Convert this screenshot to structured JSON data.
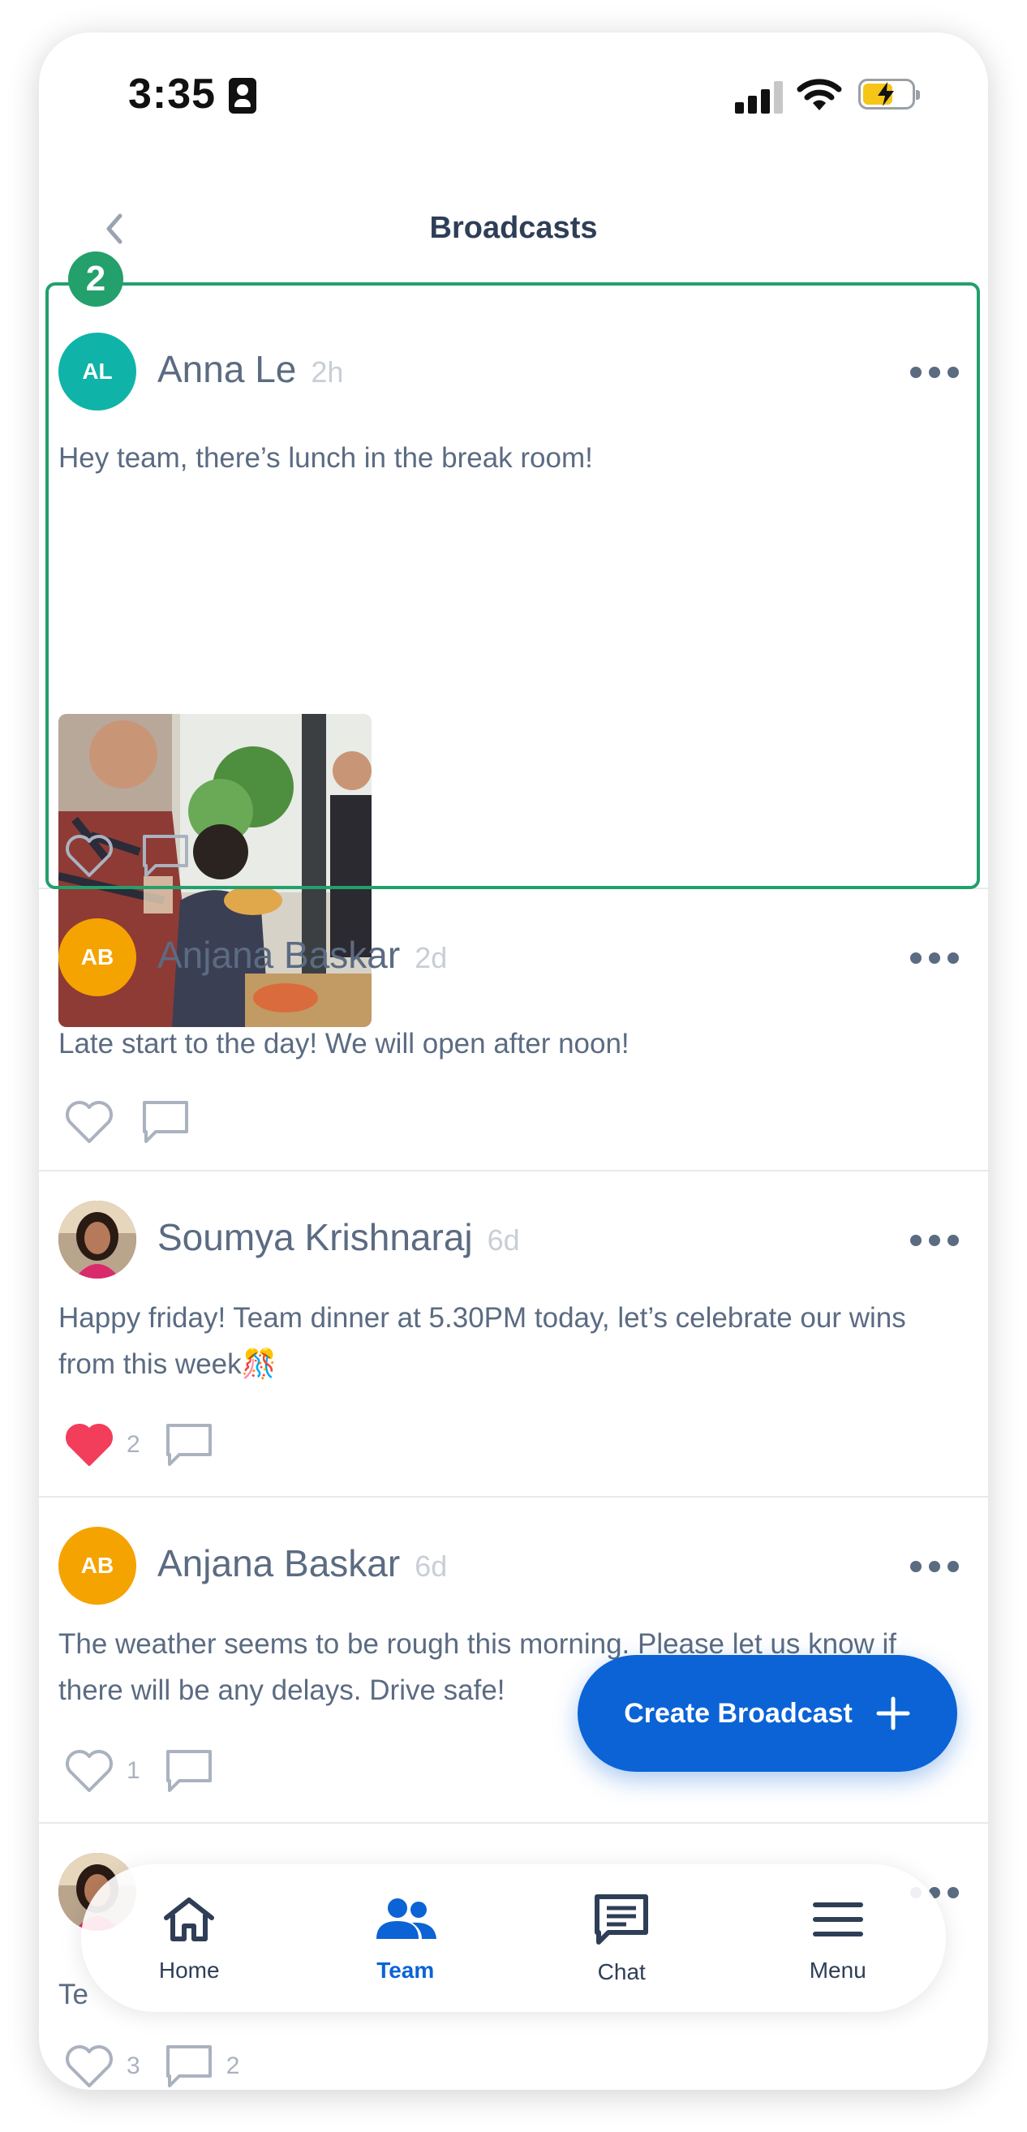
{
  "status_bar": {
    "time": "3:35"
  },
  "header": {
    "title": "Broadcasts"
  },
  "step_badge": "2",
  "posts": [
    {
      "initials": "AL",
      "avatar_color": "#10b3a8",
      "author": "Anna Le",
      "ago": "2h",
      "text": "Hey team, there’s lunch in the break room!",
      "likes": "",
      "comments": ""
    },
    {
      "initials": "AB",
      "avatar_color": "#f5a300",
      "author": "Anjana Baskar",
      "ago": "2d",
      "text": "Late start to the day! We will open after noon!",
      "likes": "",
      "comments": ""
    },
    {
      "initials": "",
      "avatar_color": "#7a5a4a",
      "author": "Soumya Krishnaraj",
      "ago": "6d",
      "text": "Happy friday! Team dinner at 5.30PM today, let’s celebrate our wins from this week🎊",
      "likes": "2",
      "comments": ""
    },
    {
      "initials": "AB",
      "avatar_color": "#f5a300",
      "author": "Anjana Baskar",
      "ago": "6d",
      "text": "The weather seems to be rough this morning. Please let us know if there will be any delays. Drive safe!",
      "likes": "1",
      "comments": ""
    },
    {
      "initials": "",
      "avatar_color": "#7a5a4a",
      "author": "",
      "ago": "",
      "text": "Te",
      "likes": "3",
      "comments": "2"
    }
  ],
  "fab": {
    "label": "Create Broadcast"
  },
  "nav": [
    {
      "label": "Home"
    },
    {
      "label": "Team"
    },
    {
      "label": "Chat"
    },
    {
      "label": "Menu"
    }
  ],
  "colors": {
    "accent": "#0b63d6",
    "highlight": "#23a06b",
    "heart": "#f23d5b"
  }
}
